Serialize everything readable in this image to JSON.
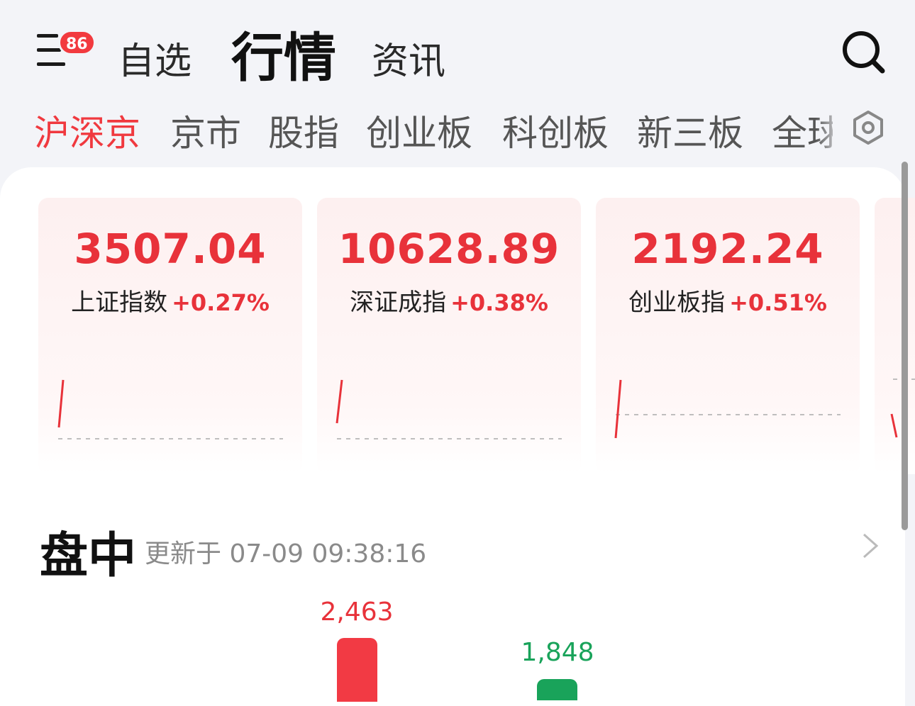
{
  "header": {
    "badge_count": "86",
    "tabs": [
      {
        "label": "自选"
      },
      {
        "label": "行情",
        "active": true
      },
      {
        "label": "资讯"
      }
    ]
  },
  "market_tabs": [
    {
      "label": "沪深京",
      "active": true
    },
    {
      "label": "京市"
    },
    {
      "label": "股指"
    },
    {
      "label": "创业板"
    },
    {
      "label": "科创板"
    },
    {
      "label": "新三板"
    },
    {
      "label": "全球"
    }
  ],
  "index_cards": [
    {
      "value": "3507.04",
      "name": "上证指数",
      "change": "+0.27%"
    },
    {
      "value": "10628.89",
      "name": "深证成指",
      "change": "+0.38%"
    },
    {
      "value": "2192.24",
      "name": "创业板指",
      "change": "+0.51%"
    }
  ],
  "section": {
    "title": "盘中",
    "update_text": "更新于 07-09 09:38:16"
  },
  "breadth": {
    "up_count": "2,463",
    "down_count": "1,848"
  },
  "colors": {
    "up": "#e8323a",
    "down": "#19a35a",
    "accent": "#f0393f"
  }
}
